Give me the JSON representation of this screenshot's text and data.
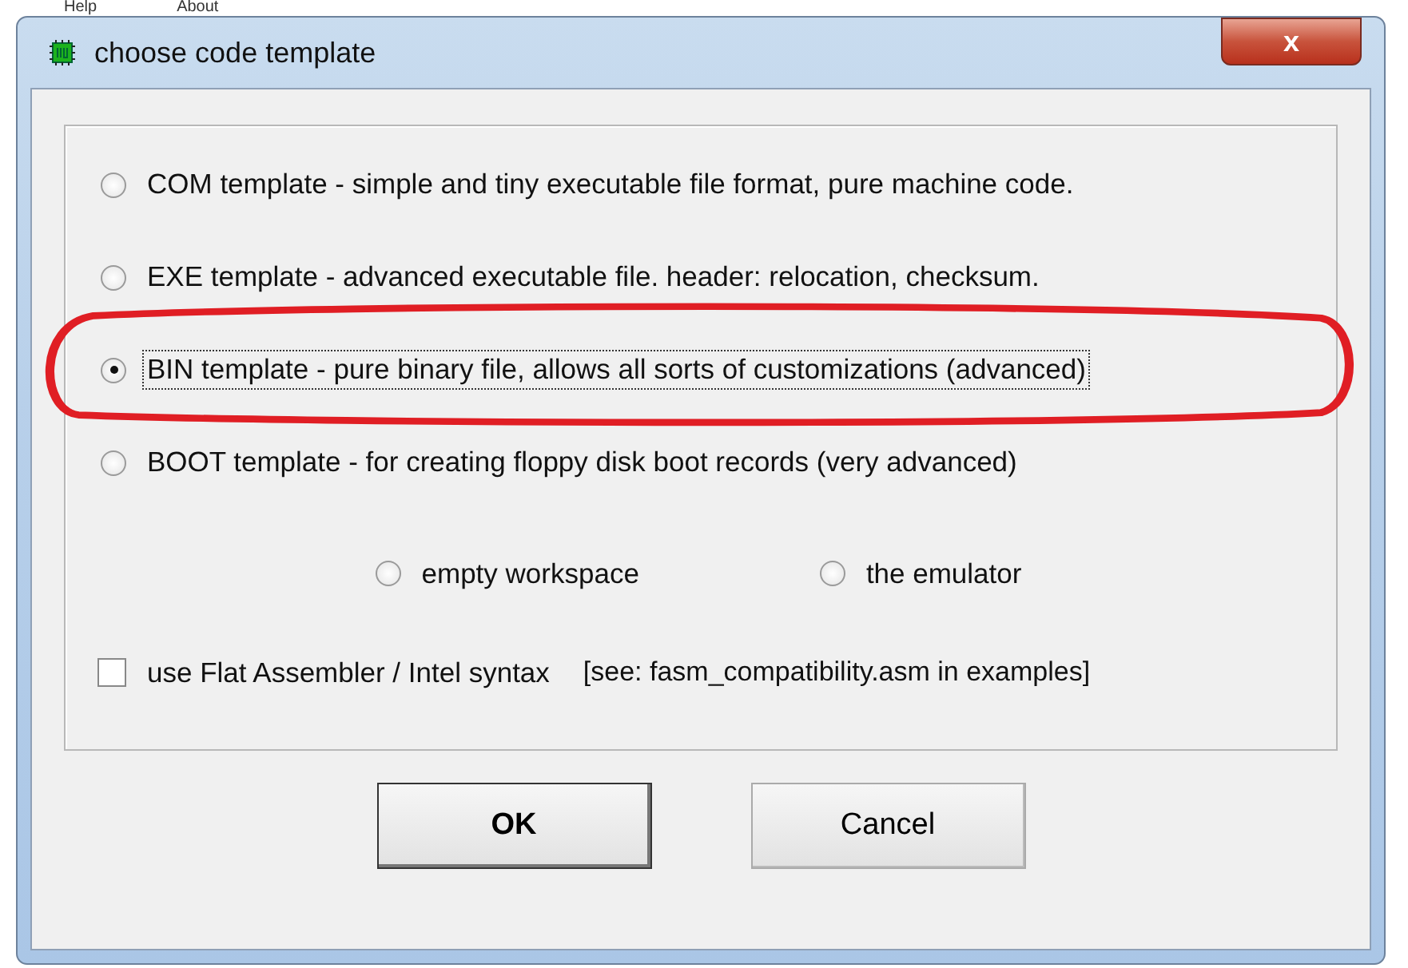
{
  "menu": [
    "Help",
    "About"
  ],
  "window": {
    "title": "choose code template",
    "close": "x"
  },
  "options": [
    {
      "label": "COM template - simple and tiny executable file format, pure machine code.",
      "selected": false,
      "focused": false,
      "highlighted": false
    },
    {
      "label": "EXE template - advanced executable file. header: relocation, checksum.",
      "selected": false,
      "focused": false,
      "highlighted": false
    },
    {
      "label": "BIN template - pure binary file, allows all sorts of customizations (advanced)",
      "selected": true,
      "focused": true,
      "highlighted": true
    },
    {
      "label": "BOOT template - for creating floppy disk boot records (very advanced)",
      "selected": false,
      "focused": false,
      "highlighted": false
    }
  ],
  "sub_options": [
    {
      "label": "empty workspace",
      "selected": false
    },
    {
      "label": "the emulator",
      "selected": false
    }
  ],
  "flat_assembler": {
    "label": "use Flat Assembler / Intel syntax",
    "note": "[see:  fasm_compatibility.asm in examples]",
    "checked": false
  },
  "buttons": [
    {
      "label": "OK",
      "default": true
    },
    {
      "label": "Cancel",
      "default": false
    }
  ]
}
